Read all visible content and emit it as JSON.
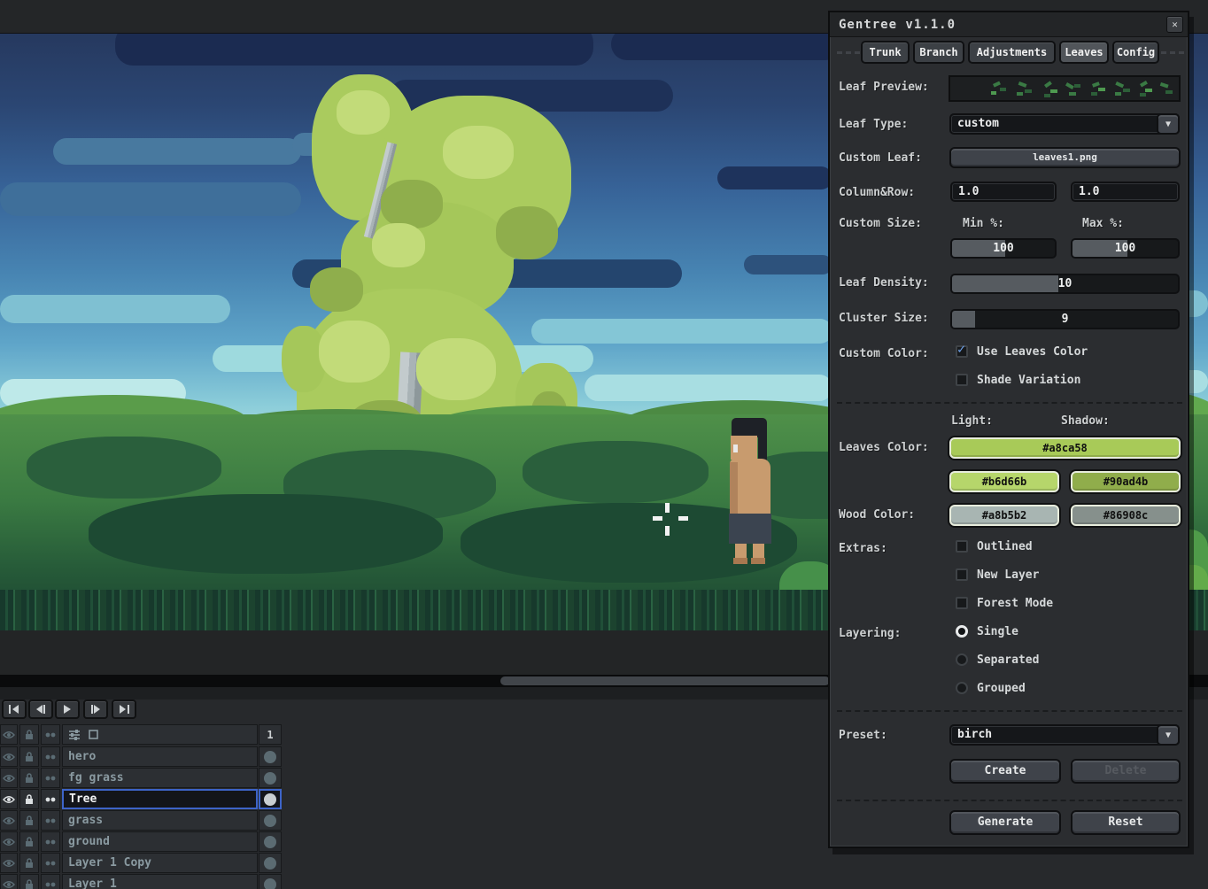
{
  "dialog": {
    "title": "Gentree v1.1.0",
    "tabs": [
      {
        "label": "Trunk"
      },
      {
        "label": "Branch"
      },
      {
        "label": "Adjustments"
      },
      {
        "label": "Leaves"
      },
      {
        "label": "Config"
      }
    ],
    "leaf_preview": {
      "label": "Leaf Preview:"
    },
    "leaf_type": {
      "label": "Leaf Type:",
      "value": "custom"
    },
    "custom_leaf": {
      "label": "Custom Leaf:",
      "value": "leaves1.png"
    },
    "column_row": {
      "label": "Column&Row:",
      "col": "1.0",
      "row": "1.0"
    },
    "custom_size": {
      "label": "Custom Size:",
      "min_label": "Min %:",
      "max_label": "Max %:",
      "min": "100",
      "max": "100"
    },
    "leaf_density": {
      "label": "Leaf Density:",
      "value": "10"
    },
    "cluster_size": {
      "label": "Cluster Size:",
      "value": "9"
    },
    "custom_color": {
      "label": "Custom Color:",
      "use_leaves_color": "Use Leaves Color",
      "shade_variation": "Shade Variation"
    },
    "colors": {
      "light_label": "Light:",
      "shadow_label": "Shadow:",
      "leaves_label": "Leaves Color:",
      "wood_label": "Wood Color:",
      "leaves_main": "#a8ca58",
      "leaves_light": "#b6d66b",
      "leaves_shadow": "#90ad4b",
      "wood_light": "#a8b5b2",
      "wood_shadow": "#86908c"
    },
    "extras": {
      "label": "Extras:",
      "options": [
        "Outlined",
        "New Layer",
        "Forest Mode"
      ]
    },
    "layering": {
      "label": "Layering:",
      "options": [
        "Single",
        "Separated",
        "Grouped"
      ],
      "selected": "Single"
    },
    "preset": {
      "label": "Preset:",
      "value": "birch",
      "create": "Create",
      "delete": "Delete"
    },
    "actions": {
      "generate": "Generate",
      "reset": "Reset"
    }
  },
  "icons": {
    "close": "✕",
    "dropdown_arrow": "▼",
    "checkmark": "✓"
  },
  "timeline": {
    "frame_header": "1",
    "layers": [
      {
        "name": "hero"
      },
      {
        "name": "fg grass"
      },
      {
        "name": "Tree",
        "selected": true
      },
      {
        "name": "grass"
      },
      {
        "name": "ground"
      },
      {
        "name": "Layer 1 Copy"
      },
      {
        "name": "Layer 1"
      }
    ]
  }
}
